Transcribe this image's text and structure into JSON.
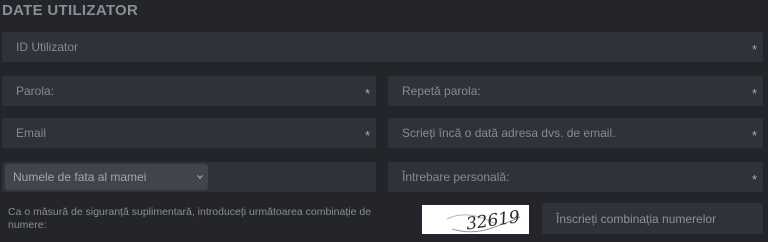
{
  "section": {
    "title": "DATE UTILIZATOR"
  },
  "fields": {
    "user_id": {
      "placeholder": "ID Utilizator",
      "required_mark": "*"
    },
    "password": {
      "placeholder": "Parola:",
      "required_mark": "*"
    },
    "password_repeat": {
      "placeholder": "Repetă parola:",
      "required_mark": "*"
    },
    "email": {
      "placeholder": "Email",
      "required_mark": "*"
    },
    "email_repeat": {
      "placeholder": "Scrieți încă o dată adresa dvs. de email.",
      "required_mark": "*"
    },
    "security_question": {
      "selected": "Numele de fata al mamei"
    },
    "personal_question": {
      "placeholder": "Întrebare personală:",
      "required_mark": "*"
    },
    "captcha_input": {
      "placeholder": "Înscrieți combinația numerelor"
    }
  },
  "security_note": "Ca o măsură de siguranță suplimentară, introduceți următoarea combinație de numere:",
  "captcha": {
    "text": "32619"
  }
}
